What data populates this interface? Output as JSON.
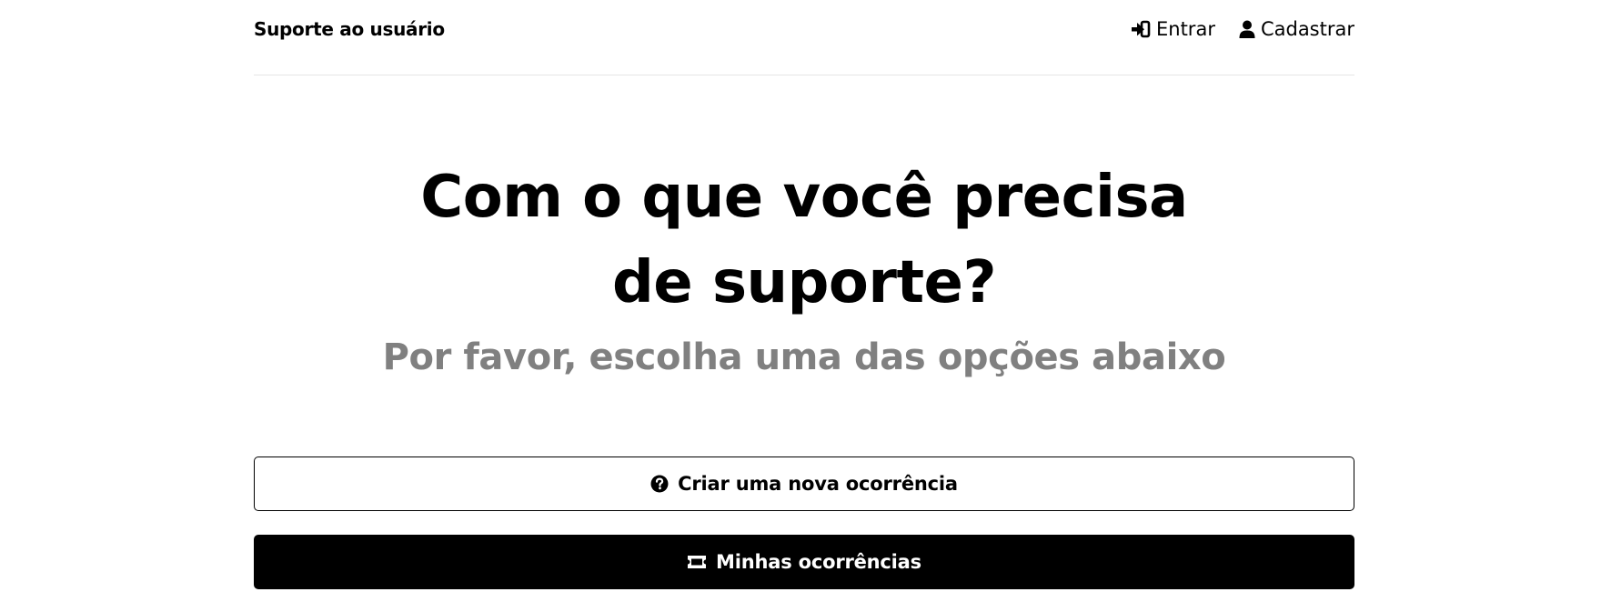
{
  "header": {
    "brand": "Suporte ao usuário",
    "nav": {
      "login": {
        "label": "Entrar",
        "icon": "sign-in-icon"
      },
      "register": {
        "label": "Cadastrar",
        "icon": "user-icon"
      }
    }
  },
  "hero": {
    "title": "Com o que você precisa de suporte?",
    "subtitle": "Por favor, escolha uma das opções abaixo"
  },
  "actions": {
    "new_ticket": {
      "label": "Criar uma nova ocorrência",
      "icon": "question-circle-icon"
    },
    "my_tickets": {
      "label": "Minhas ocorrências",
      "icon": "ticket-icon"
    }
  },
  "colors": {
    "primary": "#000000",
    "background": "#ffffff",
    "muted_text": "#808080",
    "divider": "#e6e6e6"
  }
}
